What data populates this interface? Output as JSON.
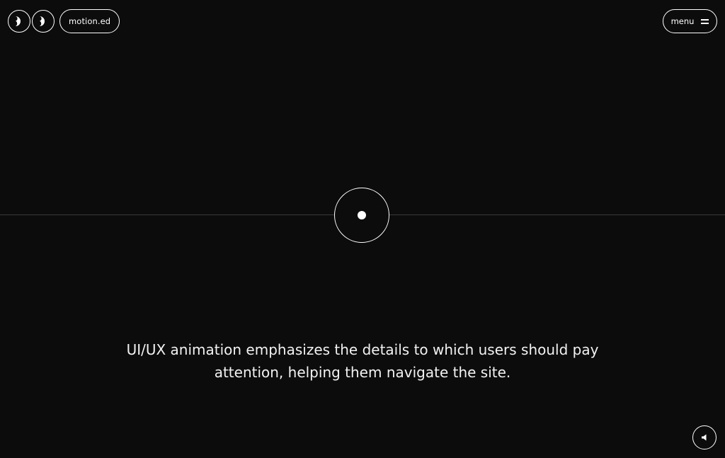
{
  "header": {
    "brand": "motion.ed",
    "menu_label": "menu"
  },
  "hero": {
    "tagline": "UI/UX animation emphasizes the details to which users should pay attention, helping them navigate the site."
  },
  "icons": {
    "logo_left": "eye-left-icon",
    "logo_right": "eye-right-icon",
    "menu": "hamburger-icon",
    "sound": "speaker-icon"
  },
  "colors": {
    "background": "#0c0c0c",
    "foreground": "#ffffff",
    "divider": "#3a3a3a"
  }
}
